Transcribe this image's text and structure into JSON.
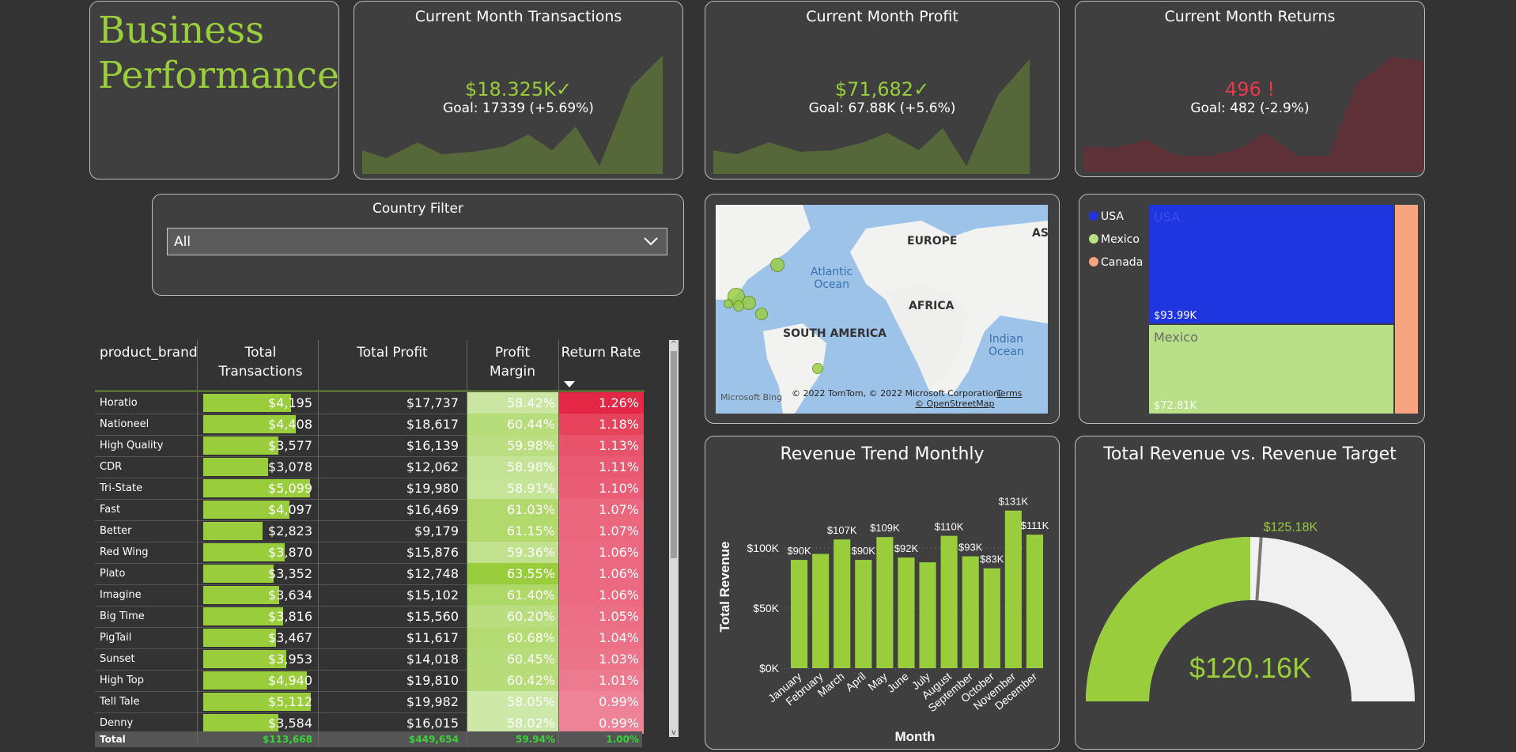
{
  "title": {
    "line1": "Business",
    "line2": "Performance"
  },
  "kpis": {
    "transactions": {
      "title": "Current Month Transactions",
      "value": "$18.325K",
      "status_icon": "check-icon",
      "goal": "Goal: 17339 (+5.69%)",
      "color": "#9acd3c"
    },
    "profit": {
      "title": "Current Month Profit",
      "value": "$71,682",
      "status_icon": "check-icon",
      "goal": "Goal: 67.88K (+5.6%)",
      "color": "#9acd3c"
    },
    "returns": {
      "title": "Current Month Returns",
      "value": "496",
      "status_icon": "!",
      "goal": "Goal: 482 (-2.9%)",
      "color": "#e8384f"
    }
  },
  "filter": {
    "label": "Country Filter",
    "selected": "All"
  },
  "table": {
    "headers": {
      "brand": "product_brand",
      "transactions": "Total Transactions",
      "profit": "Total Profit",
      "margin1": "Profit",
      "margin2": "Margin",
      "return_rate": "Return Rate"
    },
    "rows": [
      {
        "brand": "Horatio",
        "transactions": "$4,195",
        "tx_value": 4195,
        "profit": "$17,737",
        "margin": "58.42%",
        "margin_value": 58.42,
        "return_rate": "1.26%",
        "rr_value": 1.26
      },
      {
        "brand": "Nationeel",
        "transactions": "$4,408",
        "tx_value": 4408,
        "profit": "$18,617",
        "margin": "60.44%",
        "margin_value": 60.44,
        "return_rate": "1.18%",
        "rr_value": 1.18
      },
      {
        "brand": "High Quality",
        "transactions": "$3,577",
        "tx_value": 3577,
        "profit": "$16,139",
        "margin": "59.98%",
        "margin_value": 59.98,
        "return_rate": "1.13%",
        "rr_value": 1.13
      },
      {
        "brand": "CDR",
        "transactions": "$3,078",
        "tx_value": 3078,
        "profit": "$12,062",
        "margin": "58.98%",
        "margin_value": 58.98,
        "return_rate": "1.11%",
        "rr_value": 1.11
      },
      {
        "brand": "Tri-State",
        "transactions": "$5,099",
        "tx_value": 5099,
        "profit": "$19,980",
        "margin": "58.91%",
        "margin_value": 58.91,
        "return_rate": "1.10%",
        "rr_value": 1.1
      },
      {
        "brand": "Fast",
        "transactions": "$4,097",
        "tx_value": 4097,
        "profit": "$16,469",
        "margin": "61.03%",
        "margin_value": 61.03,
        "return_rate": "1.07%",
        "rr_value": 1.07
      },
      {
        "brand": "Better",
        "transactions": "$2,823",
        "tx_value": 2823,
        "profit": "$9,179",
        "margin": "61.15%",
        "margin_value": 61.15,
        "return_rate": "1.07%",
        "rr_value": 1.07
      },
      {
        "brand": "Red Wing",
        "transactions": "$3,870",
        "tx_value": 3870,
        "profit": "$15,876",
        "margin": "59.36%",
        "margin_value": 59.36,
        "return_rate": "1.06%",
        "rr_value": 1.06
      },
      {
        "brand": "Plato",
        "transactions": "$3,352",
        "tx_value": 3352,
        "profit": "$12,748",
        "margin": "63.55%",
        "margin_value": 63.55,
        "return_rate": "1.06%",
        "rr_value": 1.06
      },
      {
        "brand": "Imagine",
        "transactions": "$3,634",
        "tx_value": 3634,
        "profit": "$15,102",
        "margin": "61.40%",
        "margin_value": 61.4,
        "return_rate": "1.06%",
        "rr_value": 1.06
      },
      {
        "brand": "Big Time",
        "transactions": "$3,816",
        "tx_value": 3816,
        "profit": "$15,560",
        "margin": "60.20%",
        "margin_value": 60.2,
        "return_rate": "1.05%",
        "rr_value": 1.05
      },
      {
        "brand": "PigTail",
        "transactions": "$3,467",
        "tx_value": 3467,
        "profit": "$11,617",
        "margin": "60.68%",
        "margin_value": 60.68,
        "return_rate": "1.04%",
        "rr_value": 1.04
      },
      {
        "brand": "Sunset",
        "transactions": "$3,953",
        "tx_value": 3953,
        "profit": "$14,018",
        "margin": "60.45%",
        "margin_value": 60.45,
        "return_rate": "1.03%",
        "rr_value": 1.03
      },
      {
        "brand": "High Top",
        "transactions": "$4,940",
        "tx_value": 4940,
        "profit": "$19,810",
        "margin": "60.42%",
        "margin_value": 60.42,
        "return_rate": "1.01%",
        "rr_value": 1.01
      },
      {
        "brand": "Tell Tale",
        "transactions": "$5,112",
        "tx_value": 5112,
        "profit": "$19,982",
        "margin": "58.05%",
        "margin_value": 58.05,
        "return_rate": "0.99%",
        "rr_value": 0.99
      },
      {
        "brand": "Denny",
        "transactions": "$3,584",
        "tx_value": 3584,
        "profit": "$16,015",
        "margin": "58.02%",
        "margin_value": 58.02,
        "return_rate": "0.99%",
        "rr_value": 0.99
      }
    ],
    "total": {
      "label": "Total",
      "transactions": "$113,668",
      "profit": "$449,654",
      "margin": "59.94%",
      "return_rate": "1.00%"
    }
  },
  "map": {
    "labels": {
      "europe": "EUROPE",
      "africa": "AFRICA",
      "south_america": "SOUTH AMERICA",
      "asia": "ASI"
    },
    "oceans": {
      "atlantic1": "Atlantic",
      "atlantic2": "Ocean",
      "indian1": "Indian",
      "indian2": "Ocean"
    },
    "copyright": "© 2022 TomTom, © 2022 Microsoft Corporation,",
    "terms": "Terms",
    "osm": "© OpenStreetMap",
    "bing": "Microsoft Bing"
  },
  "treemap": {
    "legend": [
      {
        "name": "USA",
        "color": "#1f35e0"
      },
      {
        "name": "Mexico",
        "color": "#b9e089"
      },
      {
        "name": "Canada",
        "color": "#f7a47f"
      }
    ],
    "usa": {
      "name": "USA",
      "value": "$93.99K"
    },
    "mexico": {
      "name": "Mexico",
      "value": "$72.81K"
    }
  },
  "chart_data": [
    {
      "type": "bar",
      "title": "Revenue Trend Monthly",
      "xlabel": "Month",
      "ylabel": "Total Revenue",
      "categories": [
        "January",
        "February",
        "March",
        "April",
        "May",
        "June",
        "July",
        "August",
        "September",
        "October",
        "November",
        "December"
      ],
      "values": [
        90,
        95,
        107,
        90,
        109,
        92,
        88,
        110,
        93,
        83,
        131,
        111
      ],
      "data_labels": [
        "$90K",
        "",
        "$107K",
        "$90K",
        "$109K",
        "$92K",
        "",
        "$110K",
        "$93K",
        "$83K",
        "$131K",
        "$111K"
      ],
      "yticks": [
        {
          "v": 0,
          "label": "$0K"
        },
        {
          "v": 50,
          "label": "$50K"
        },
        {
          "v": 100,
          "label": "$100K"
        }
      ],
      "ylim": [
        0,
        140
      ],
      "color": "#9acd3c"
    },
    {
      "type": "gauge",
      "title": "Total Revenue vs. Revenue Target",
      "value": 120.16,
      "value_label": "$120.16K",
      "target": 125.18,
      "target_label": "$125.18K",
      "max": 240.32,
      "fill_color": "#9acd3c",
      "track_color": "#f0f0f0"
    }
  ]
}
